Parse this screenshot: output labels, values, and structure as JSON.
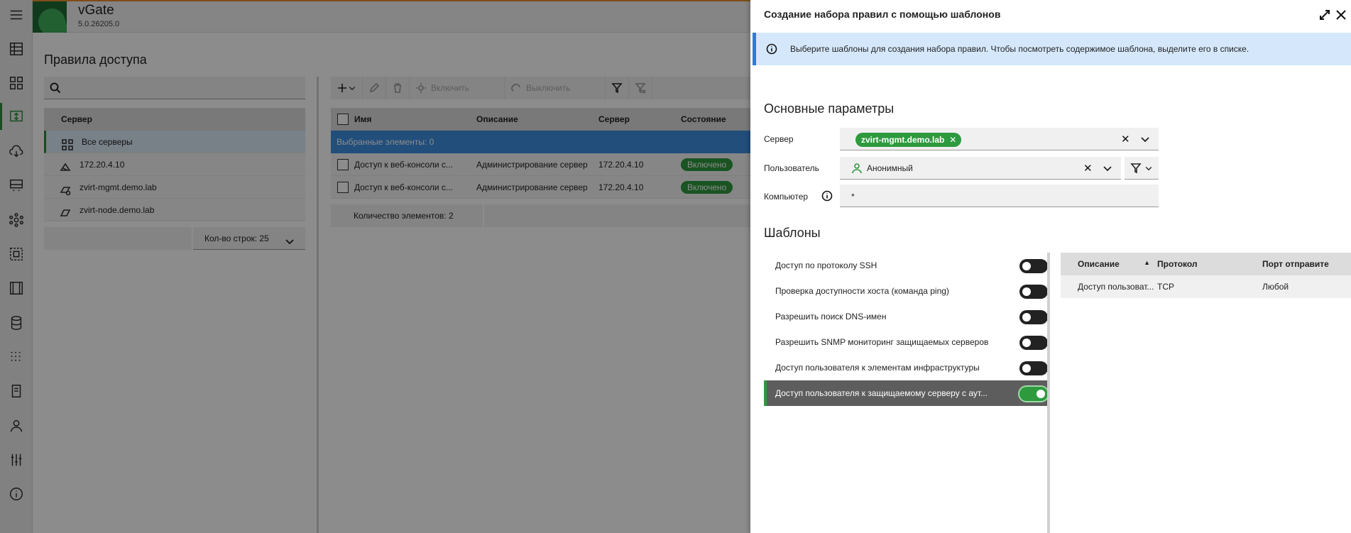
{
  "app": {
    "title": "vGate",
    "version": "5.0.26205.0"
  },
  "page": {
    "title": "Правила доступа"
  },
  "servers": {
    "search_placeholder": "",
    "header": "Сервер",
    "items": [
      {
        "label": "Все серверы",
        "icon": "all-servers-icon"
      },
      {
        "label": "172.20.4.10",
        "icon": "server-icon"
      },
      {
        "label": "zvirt-mgmt.demo.lab",
        "icon": "server-mgmt-icon"
      },
      {
        "label": "zvirt-node.demo.lab",
        "icon": "server-node-icon"
      }
    ],
    "rows_label": "Кол-во строк: 25"
  },
  "toolbar": {
    "enable": "Включить",
    "disable": "Выключить"
  },
  "rules": {
    "columns": {
      "name": "Имя",
      "description": "Описание",
      "server": "Сервер",
      "state": "Состояние"
    },
    "selected": "Выбранные элементы: 0",
    "rows": [
      {
        "name": "Доступ к веб-консоли с...",
        "description": "Администрирование сервер",
        "server": "172.20.4.10",
        "state": "Включено"
      },
      {
        "name": "Доступ к веб-консоли с...",
        "description": "Администрирование сервер",
        "server": "172.20.4.10",
        "state": "Включено"
      }
    ],
    "count": "Количество элементов: 2"
  },
  "dialog": {
    "title": "Создание набора правил с помощью шаблонов",
    "info": "Выберите шаблоны для создания набора правил. Чтобы посмотреть содержимое шаблона, выделите его в списке.",
    "basic_section": "Основные параметры",
    "server_label": "Сервер",
    "server_value": "zvirt-mgmt.demo.lab",
    "user_label": "Пользователь",
    "user_value": "Анонимный",
    "computer_label": "Компьютер",
    "computer_value": "*",
    "templates_section": "Шаблоны",
    "templates": [
      {
        "label": "Доступ по протоколу SSH",
        "enabled": false
      },
      {
        "label": "Проверка доступности хоста (команда ping)",
        "enabled": false
      },
      {
        "label": "Разрешить поиск DNS-имен",
        "enabled": false
      },
      {
        "label": "Разрешить SNMP мониторинг защищаемых серверов",
        "enabled": false
      },
      {
        "label": "Доступ пользователя к элементам инфраструктуры",
        "enabled": false
      },
      {
        "label": "Доступ пользователя к защищаемому серверу с аут...",
        "enabled": true
      }
    ],
    "details": {
      "columns": {
        "description": "Описание",
        "protocol": "Протокол",
        "port": "Порт отправите"
      },
      "rows": [
        {
          "description": "Доступ пользоват...",
          "protocol": "TCP",
          "port": "Любой"
        }
      ]
    }
  },
  "colors": {
    "accent_green": "#2e9a3e",
    "info_blue": "#2c7be5",
    "selection_blue": "#3d8fe0"
  }
}
